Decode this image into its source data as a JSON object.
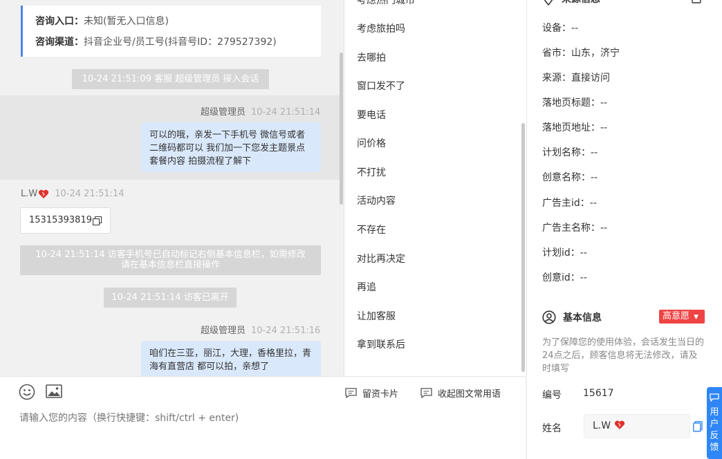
{
  "chat": {
    "info_card": {
      "entry_label": "咨询入口：",
      "entry_value": "未知(暂无入口信息)",
      "channel_label": "咨询渠道：",
      "channel_value": "抖音企业号/员工号(抖音号ID：279527392)"
    },
    "sys_join": "10-24 21:51:09 客服 超级管理员 接入会话",
    "msg1": {
      "sender": "超级管理员",
      "time": "10-24 21:51:14",
      "text": "可以的哦，亲发一下手机号 微信号或者二维码都可以 我们加一下您发主题景点 套餐内容 拍摄流程了解下"
    },
    "visitor": {
      "name": "L.W",
      "time": "10-24 21:51:14",
      "phone": "15315393819"
    },
    "sys_mark_line1": "10-24 21:51:14 访客手机号已自动标记右侧基本信息栏，如需修改",
    "sys_mark_line2": "请在基本信息栏直接操作",
    "sys_left": "10-24 21:51:14 访客已离开",
    "msg2": {
      "sender": "超级管理员",
      "time": "10-24 21:51:16",
      "text": "咱们在三亚，丽江，大理，香格里拉，青海有直营店 都可以拍，亲想了"
    }
  },
  "input": {
    "placeholder": "请输入您的内容（换行快捷键：shift/ctrl + enter)",
    "lead_card_label": "留资卡片",
    "collapse_label": "收起图文常用语"
  },
  "quick_replies": [
    "考虑热门城市",
    "考虑旅拍吗",
    "去哪拍",
    "窗口发不了",
    "要电话",
    "问价格",
    "不打扰",
    "活动内容",
    "不存在",
    "对比再决定",
    "再追",
    "让加客服",
    "拿到联系后"
  ],
  "source_info": {
    "title": "来源信息",
    "rows": [
      "设备：--",
      "省市：山东，济宁",
      "来源：直接访问",
      "落地页标题：--",
      "落地页地址：--",
      "计划名称：--",
      "创意名称：--",
      "广告主id：--",
      "广告主名称：--",
      "计划id：--",
      "创意id：--"
    ]
  },
  "basic_info": {
    "title": "基本信息",
    "intent_badge": "高意愿",
    "note": "为了保障您的使用体验，会话发生当日的24点之后，顾客信息将无法修改，请及时填写",
    "id_label": "编号",
    "id_value": "15617",
    "name_label": "姓名",
    "name_value": "L.W"
  },
  "feedback": {
    "label": "用户反馈"
  },
  "colors": {
    "accent": "#4a86e8",
    "badge_red": "#f04343",
    "bubble_blue": "#dae8fb",
    "feedback_blue": "#2f86f6"
  }
}
